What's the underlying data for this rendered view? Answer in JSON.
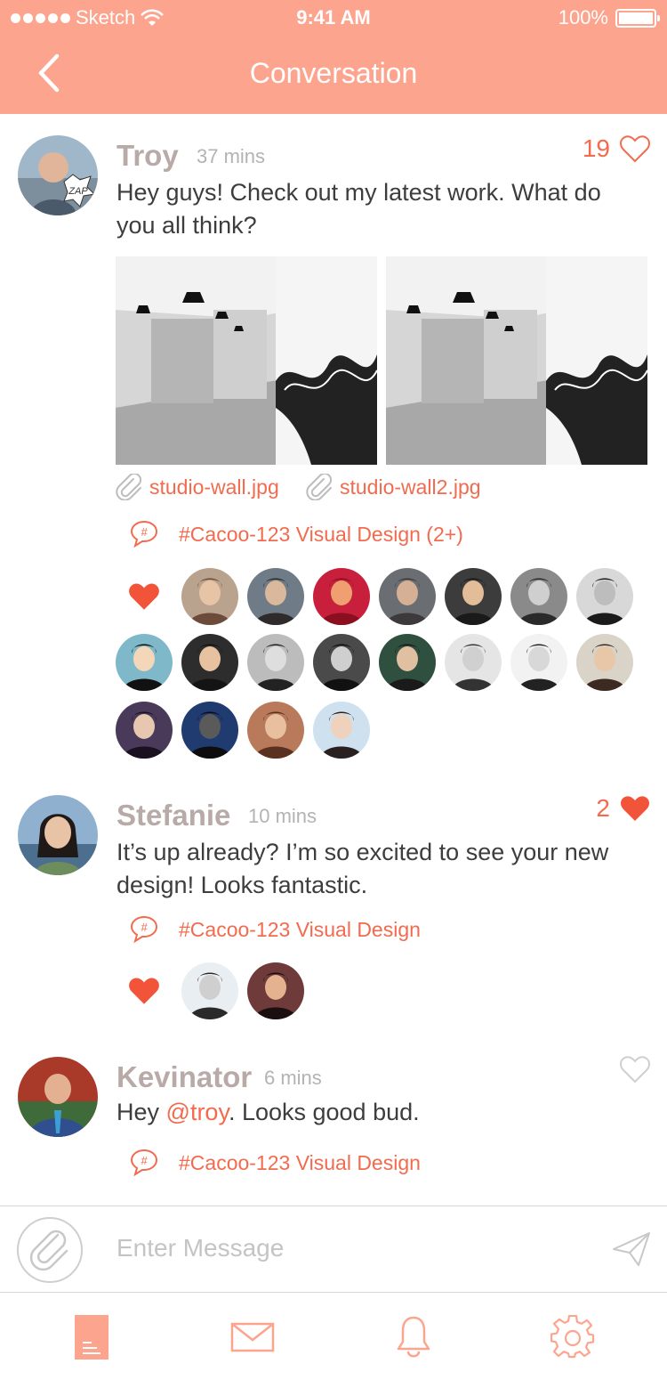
{
  "status_bar": {
    "carrier": "Sketch",
    "time": "9:41 AM",
    "battery": "100%"
  },
  "header": {
    "title": "Conversation"
  },
  "posts": [
    {
      "name": "Troy",
      "time": "37 mins",
      "message": "Hey guys! Check out my latest work. What do you all think?",
      "likes": "19",
      "liked": false,
      "attachments": [
        "studio-wall.jpg",
        "studio-wall2.jpg"
      ],
      "tag": "#Cacoo-123 Visual Design (2+)",
      "liker_count": 18
    },
    {
      "name": "Stefanie",
      "time": "10 mins",
      "message": "It’s up already? I’m so excited to see your new design! Looks fantastic.",
      "likes": "2",
      "liked": true,
      "tag": "#Cacoo-123 Visual Design",
      "liker_count": 2
    },
    {
      "name": "Kevinator",
      "time": "6 mins",
      "message_parts": {
        "before": "Hey ",
        "mention": "@troy",
        "after": ". Looks good bud."
      },
      "likes": "",
      "liked": false,
      "tag": "#Cacoo-123 Visual Design"
    }
  ],
  "composer": {
    "placeholder": "Enter Message"
  },
  "tabs": [
    {
      "icon": "document-icon",
      "active": true
    },
    {
      "icon": "mail-icon",
      "active": false
    },
    {
      "icon": "bell-icon",
      "active": false
    },
    {
      "icon": "gear-icon",
      "active": false
    }
  ],
  "colors": {
    "header": "#FDA48E",
    "accent": "#F26B4E",
    "name": "#b8aaa6"
  }
}
